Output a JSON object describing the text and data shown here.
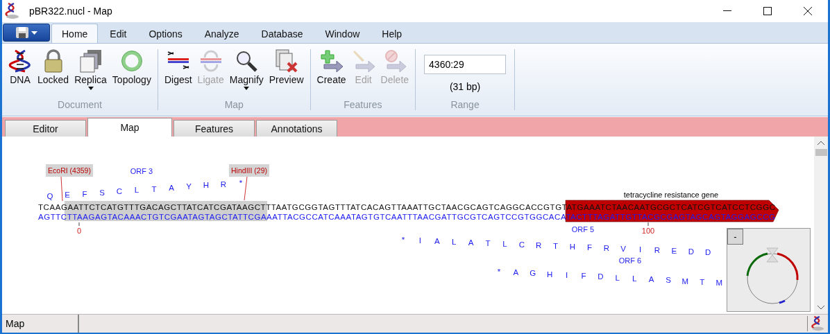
{
  "window": {
    "title": "pBR322.nucl - Map"
  },
  "menu_tabs": [
    {
      "label": "Home",
      "selected": true
    },
    {
      "label": "Edit",
      "selected": false
    },
    {
      "label": "Options",
      "selected": false
    },
    {
      "label": "Analyze",
      "selected": false
    },
    {
      "label": "Database",
      "selected": false
    },
    {
      "label": "Window",
      "selected": false
    },
    {
      "label": "Help",
      "selected": false
    }
  ],
  "ribbon_groups": [
    {
      "label": "Document",
      "buttons": [
        {
          "kind": "dna",
          "label": "DNA",
          "disabled": false,
          "dropdown": false
        },
        {
          "kind": "lock",
          "label": "Locked",
          "disabled": false,
          "dropdown": false
        },
        {
          "kind": "windows",
          "label": "Replica",
          "disabled": false,
          "dropdown": true
        },
        {
          "kind": "ring",
          "label": "Topology",
          "disabled": false,
          "dropdown": false
        }
      ]
    },
    {
      "label": "Map",
      "buttons": [
        {
          "kind": "scissors",
          "label": "Digest",
          "disabled": false,
          "dropdown": false
        },
        {
          "kind": "join",
          "label": "Ligate",
          "disabled": true,
          "dropdown": false
        },
        {
          "kind": "magnifier",
          "label": "Magnify",
          "disabled": false,
          "dropdown": true
        },
        {
          "kind": "pages",
          "label": "Preview",
          "disabled": false,
          "dropdown": false
        }
      ]
    },
    {
      "label": "Features",
      "buttons": [
        {
          "kind": "plus",
          "label": "Create",
          "disabled": false,
          "dropdown": false
        },
        {
          "kind": "pencil",
          "label": "Edit",
          "disabled": true,
          "dropdown": false
        },
        {
          "kind": "forbid",
          "label": "Delete",
          "disabled": true,
          "dropdown": false
        }
      ]
    }
  ],
  "range": {
    "label": "Range",
    "value": "4360:29",
    "length": "(31 bp)"
  },
  "view_tabs": [
    {
      "label": "Editor",
      "selected": false
    },
    {
      "label": "Map",
      "selected": true
    },
    {
      "label": "Features",
      "selected": false
    },
    {
      "label": "Annotations",
      "selected": false
    }
  ],
  "map": {
    "sites": [
      {
        "label": "EcoRI (4359)"
      },
      {
        "label": "HindIII (29)"
      }
    ],
    "orfs": [
      {
        "name": "ORF 3",
        "residues": [
          "Q",
          "E",
          "F",
          "S",
          "C",
          "L",
          "T",
          "A",
          "Y",
          "H",
          "R",
          "*"
        ]
      },
      {
        "name": "ORF 5",
        "residues": [
          "*",
          "I",
          "A",
          "L",
          "A",
          "T",
          "L",
          "C",
          "R",
          "T",
          "H",
          "F",
          "R",
          "V",
          "I",
          "R",
          "E",
          "D",
          "D"
        ]
      },
      {
        "name": "ORF 6",
        "residues": [
          "*",
          "A",
          "G",
          "H",
          "I",
          "F",
          "D",
          "L",
          "L",
          "A",
          "S",
          "M",
          "T",
          "M"
        ]
      }
    ],
    "top_strand": "TCAAGAATTCTCATGTTTGACAGCTTATCATCGATAAGCTTTAATGCGGTAGTTTATCACAGTTAAATTGCTAACGCAGTCAGGCACCGTGTATGAAATCTAACAATGCGCTCATCGTCATCCTCGGC",
    "bottom_strand": "AGTTCTTAAGAGTACAAACTGTCGAATAGTAGCTATTCGAAATTACGCCATCAAATAGTGTCAATTTAACGATTGCGTCAGTCCGTGGCACATACTTTAGATTGTTACGCGAGTAGCAGTAGGAGCCG",
    "feature": {
      "label": "tetracycline resistance gene",
      "color": "#c00000"
    },
    "ticks": [
      "0",
      "100"
    ],
    "overview": {
      "button": "-"
    }
  },
  "status_bar": {
    "text": "Map"
  }
}
